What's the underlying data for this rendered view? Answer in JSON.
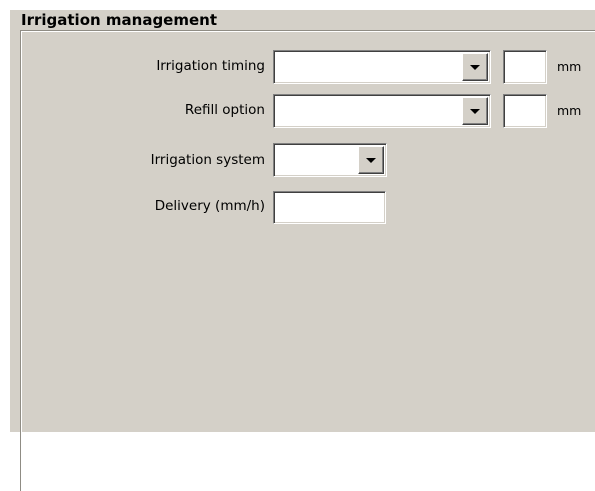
{
  "group": {
    "title": "Irrigation management"
  },
  "fields": {
    "irrigation_timing": {
      "label": "Irrigation timing",
      "selected": "",
      "amount": "",
      "unit": "mm"
    },
    "refill_option": {
      "label": "Refill option",
      "selected": "",
      "amount": "",
      "unit": "mm"
    },
    "irrigation_system": {
      "label": "Irrigation system",
      "selected": ""
    },
    "delivery": {
      "label": "Delivery (mm/h)",
      "value": ""
    }
  },
  "icons": {
    "dropdown": "chevron-down-icon"
  }
}
